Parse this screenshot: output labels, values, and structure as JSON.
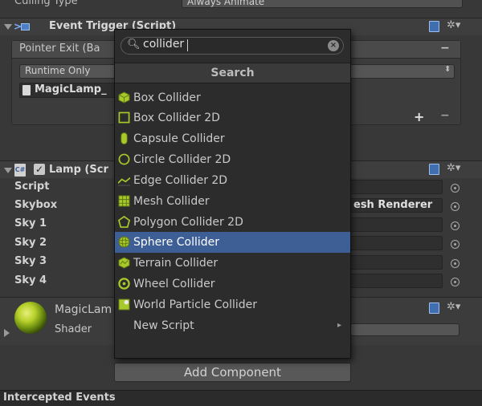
{
  "culling": {
    "label": "Culling Type",
    "value": "Always Animate"
  },
  "event_trigger": {
    "title": "Event Trigger (Script)",
    "event_label": "Pointer Exit (Ba",
    "runtime": "Runtime Only",
    "object": "MagicLamp_",
    "add": "+",
    "remove": "−",
    "remove_event": "−"
  },
  "lamp": {
    "title": "Lamp (Scr",
    "properties": [
      {
        "label": "Script",
        "value": ""
      },
      {
        "label": "Skybox",
        "value": "esh Renderer"
      },
      {
        "label": "Sky 1",
        "value": ""
      },
      {
        "label": "Sky 2",
        "value": ""
      },
      {
        "label": "Sky 3",
        "value": ""
      },
      {
        "label": "Sky 4",
        "value": ""
      }
    ]
  },
  "material": {
    "name": "MagicLam",
    "shader_label": "Shader",
    "shader_value": ""
  },
  "popup": {
    "search_text": "collider",
    "header": "Search",
    "results": [
      {
        "label": "Box Collider",
        "icon": "box-collider-icon"
      },
      {
        "label": "Box Collider 2D",
        "icon": "box-collider-2d-icon"
      },
      {
        "label": "Capsule Collider",
        "icon": "capsule-collider-icon"
      },
      {
        "label": "Circle Collider 2D",
        "icon": "circle-collider-2d-icon"
      },
      {
        "label": "Edge Collider 2D",
        "icon": "edge-collider-2d-icon"
      },
      {
        "label": "Mesh Collider",
        "icon": "mesh-collider-icon"
      },
      {
        "label": "Polygon Collider 2D",
        "icon": "polygon-collider-2d-icon"
      },
      {
        "label": "Sphere Collider",
        "icon": "sphere-collider-icon"
      },
      {
        "label": "Terrain Collider",
        "icon": "terrain-collider-icon"
      },
      {
        "label": "Wheel Collider",
        "icon": "wheel-collider-icon"
      },
      {
        "label": "World Particle Collider",
        "icon": "world-particle-collider-icon"
      },
      {
        "label": "New Script",
        "icon": ""
      }
    ],
    "selected": "Sphere Collider"
  },
  "add_component": "Add Component",
  "intercepted_events": "Intercepted Events",
  "colors": {
    "accent_green": "#a8c92a",
    "selection": "#3e5f96"
  }
}
